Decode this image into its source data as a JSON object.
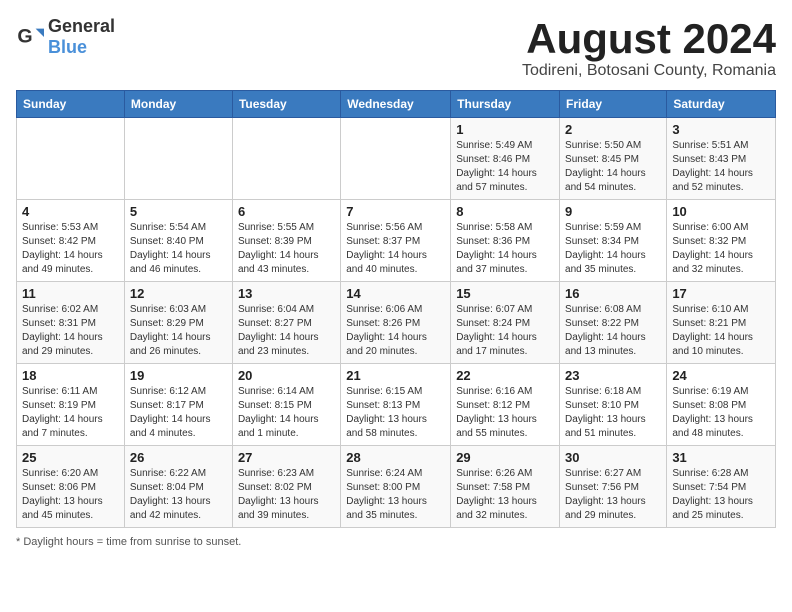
{
  "header": {
    "logo_general": "General",
    "logo_blue": "Blue",
    "month_year": "August 2024",
    "location": "Todireni, Botosani County, Romania"
  },
  "days_of_week": [
    "Sunday",
    "Monday",
    "Tuesday",
    "Wednesday",
    "Thursday",
    "Friday",
    "Saturday"
  ],
  "footer": {
    "note": "Daylight hours"
  },
  "weeks": [
    {
      "days": [
        {
          "number": "",
          "info": ""
        },
        {
          "number": "",
          "info": ""
        },
        {
          "number": "",
          "info": ""
        },
        {
          "number": "",
          "info": ""
        },
        {
          "number": "1",
          "info": "Sunrise: 5:49 AM\nSunset: 8:46 PM\nDaylight: 14 hours\nand 57 minutes."
        },
        {
          "number": "2",
          "info": "Sunrise: 5:50 AM\nSunset: 8:45 PM\nDaylight: 14 hours\nand 54 minutes."
        },
        {
          "number": "3",
          "info": "Sunrise: 5:51 AM\nSunset: 8:43 PM\nDaylight: 14 hours\nand 52 minutes."
        }
      ]
    },
    {
      "days": [
        {
          "number": "4",
          "info": "Sunrise: 5:53 AM\nSunset: 8:42 PM\nDaylight: 14 hours\nand 49 minutes."
        },
        {
          "number": "5",
          "info": "Sunrise: 5:54 AM\nSunset: 8:40 PM\nDaylight: 14 hours\nand 46 minutes."
        },
        {
          "number": "6",
          "info": "Sunrise: 5:55 AM\nSunset: 8:39 PM\nDaylight: 14 hours\nand 43 minutes."
        },
        {
          "number": "7",
          "info": "Sunrise: 5:56 AM\nSunset: 8:37 PM\nDaylight: 14 hours\nand 40 minutes."
        },
        {
          "number": "8",
          "info": "Sunrise: 5:58 AM\nSunset: 8:36 PM\nDaylight: 14 hours\nand 37 minutes."
        },
        {
          "number": "9",
          "info": "Sunrise: 5:59 AM\nSunset: 8:34 PM\nDaylight: 14 hours\nand 35 minutes."
        },
        {
          "number": "10",
          "info": "Sunrise: 6:00 AM\nSunset: 8:32 PM\nDaylight: 14 hours\nand 32 minutes."
        }
      ]
    },
    {
      "days": [
        {
          "number": "11",
          "info": "Sunrise: 6:02 AM\nSunset: 8:31 PM\nDaylight: 14 hours\nand 29 minutes."
        },
        {
          "number": "12",
          "info": "Sunrise: 6:03 AM\nSunset: 8:29 PM\nDaylight: 14 hours\nand 26 minutes."
        },
        {
          "number": "13",
          "info": "Sunrise: 6:04 AM\nSunset: 8:27 PM\nDaylight: 14 hours\nand 23 minutes."
        },
        {
          "number": "14",
          "info": "Sunrise: 6:06 AM\nSunset: 8:26 PM\nDaylight: 14 hours\nand 20 minutes."
        },
        {
          "number": "15",
          "info": "Sunrise: 6:07 AM\nSunset: 8:24 PM\nDaylight: 14 hours\nand 17 minutes."
        },
        {
          "number": "16",
          "info": "Sunrise: 6:08 AM\nSunset: 8:22 PM\nDaylight: 14 hours\nand 13 minutes."
        },
        {
          "number": "17",
          "info": "Sunrise: 6:10 AM\nSunset: 8:21 PM\nDaylight: 14 hours\nand 10 minutes."
        }
      ]
    },
    {
      "days": [
        {
          "number": "18",
          "info": "Sunrise: 6:11 AM\nSunset: 8:19 PM\nDaylight: 14 hours\nand 7 minutes."
        },
        {
          "number": "19",
          "info": "Sunrise: 6:12 AM\nSunset: 8:17 PM\nDaylight: 14 hours\nand 4 minutes."
        },
        {
          "number": "20",
          "info": "Sunrise: 6:14 AM\nSunset: 8:15 PM\nDaylight: 14 hours\nand 1 minute."
        },
        {
          "number": "21",
          "info": "Sunrise: 6:15 AM\nSunset: 8:13 PM\nDaylight: 13 hours\nand 58 minutes."
        },
        {
          "number": "22",
          "info": "Sunrise: 6:16 AM\nSunset: 8:12 PM\nDaylight: 13 hours\nand 55 minutes."
        },
        {
          "number": "23",
          "info": "Sunrise: 6:18 AM\nSunset: 8:10 PM\nDaylight: 13 hours\nand 51 minutes."
        },
        {
          "number": "24",
          "info": "Sunrise: 6:19 AM\nSunset: 8:08 PM\nDaylight: 13 hours\nand 48 minutes."
        }
      ]
    },
    {
      "days": [
        {
          "number": "25",
          "info": "Sunrise: 6:20 AM\nSunset: 8:06 PM\nDaylight: 13 hours\nand 45 minutes."
        },
        {
          "number": "26",
          "info": "Sunrise: 6:22 AM\nSunset: 8:04 PM\nDaylight: 13 hours\nand 42 minutes."
        },
        {
          "number": "27",
          "info": "Sunrise: 6:23 AM\nSunset: 8:02 PM\nDaylight: 13 hours\nand 39 minutes."
        },
        {
          "number": "28",
          "info": "Sunrise: 6:24 AM\nSunset: 8:00 PM\nDaylight: 13 hours\nand 35 minutes."
        },
        {
          "number": "29",
          "info": "Sunrise: 6:26 AM\nSunset: 7:58 PM\nDaylight: 13 hours\nand 32 minutes."
        },
        {
          "number": "30",
          "info": "Sunrise: 6:27 AM\nSunset: 7:56 PM\nDaylight: 13 hours\nand 29 minutes."
        },
        {
          "number": "31",
          "info": "Sunrise: 6:28 AM\nSunset: 7:54 PM\nDaylight: 13 hours\nand 25 minutes."
        }
      ]
    }
  ]
}
